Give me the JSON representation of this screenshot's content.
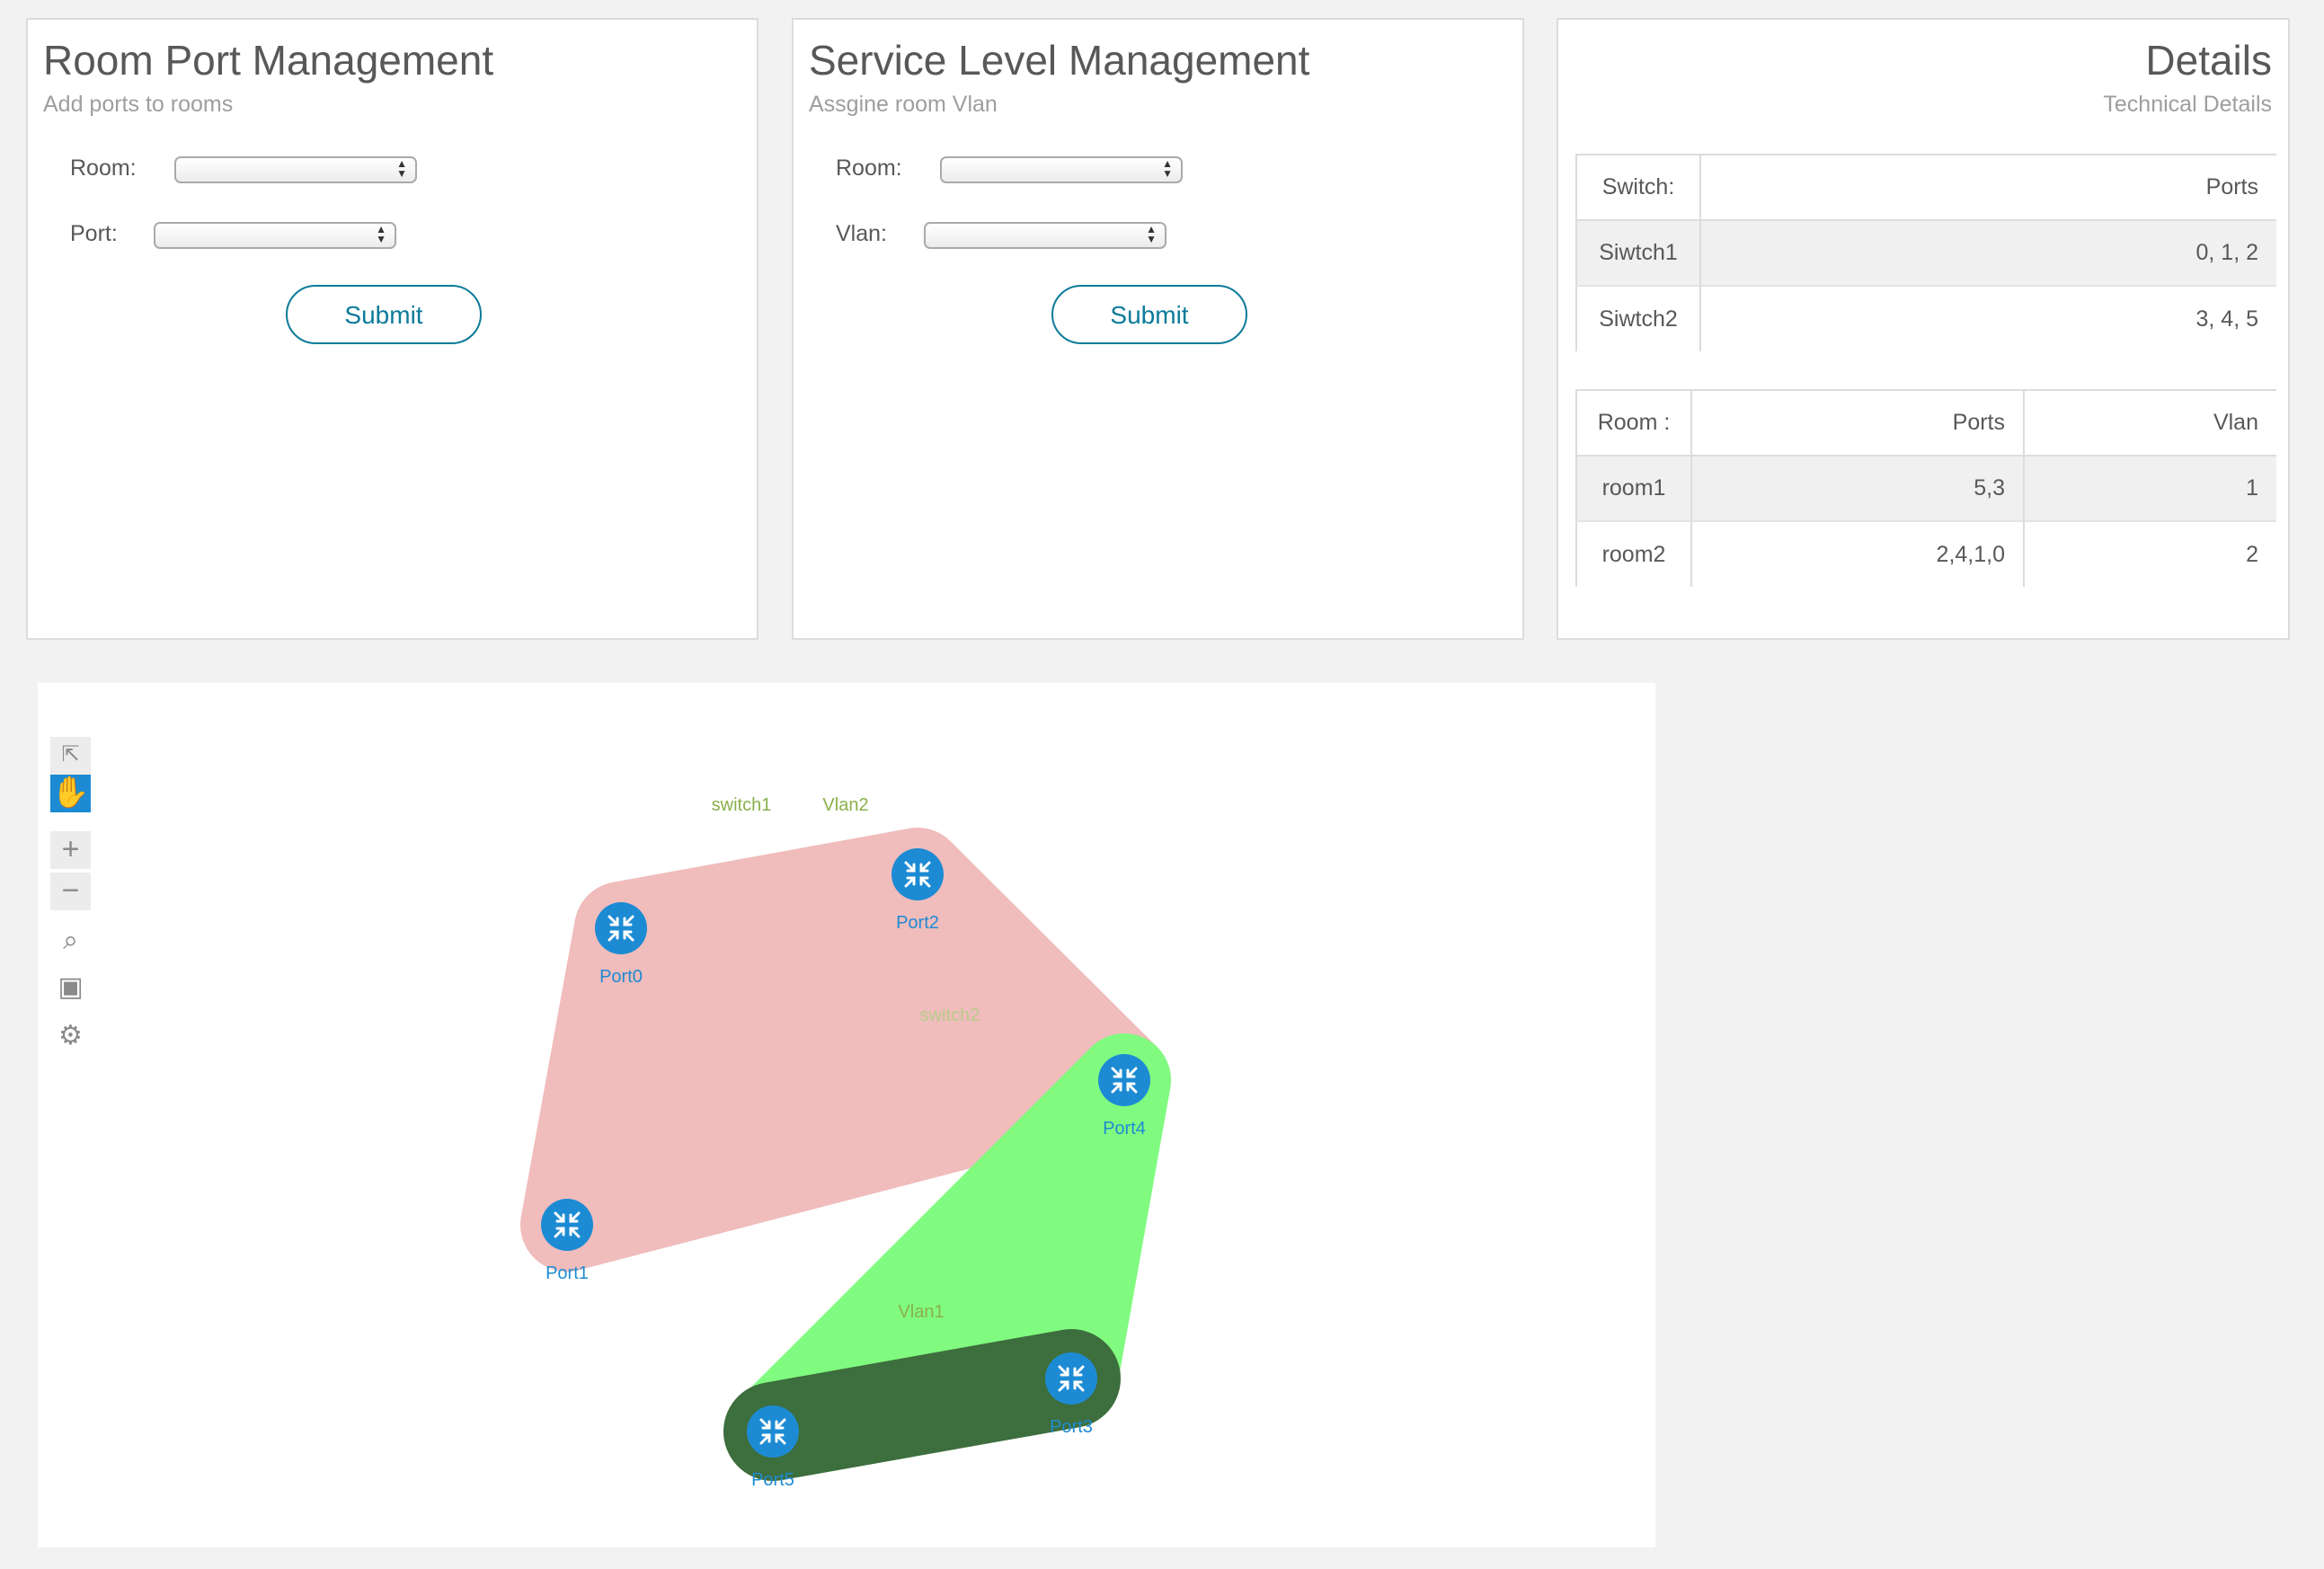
{
  "room_port": {
    "title": "Room Port Management",
    "subtitle": "Add ports to rooms",
    "room_label": "Room:",
    "port_label": "Port:",
    "room_value": "",
    "port_value": "",
    "submit_label": "Submit"
  },
  "service_level": {
    "title": "Service Level Management",
    "subtitle": "Assgine room Vlan",
    "room_label": "Room:",
    "vlan_label": "Vlan:",
    "room_value": "",
    "vlan_value": "",
    "submit_label": "Submit"
  },
  "details": {
    "title": "Details",
    "subtitle": "Technical Details",
    "switch_table": {
      "headers": [
        "Switch:",
        "Ports"
      ],
      "rows": [
        [
          "Siwtch1",
          "0, 1, 2"
        ],
        [
          "Siwtch2",
          "3, 4, 5"
        ]
      ]
    },
    "room_table": {
      "headers": [
        "Room :",
        "Ports",
        "Vlan"
      ],
      "rows": [
        [
          "room1",
          "5,3",
          "1"
        ],
        [
          "room2",
          "2,4,1,0",
          "2"
        ]
      ]
    }
  },
  "topology": {
    "toolbar": [
      {
        "name": "select-mode-icon",
        "glyph": "↖"
      },
      {
        "name": "pan-mode-icon",
        "glyph": "✋"
      },
      {
        "name": "zoom-in-icon",
        "glyph": "+"
      },
      {
        "name": "zoom-out-icon",
        "glyph": "−"
      },
      {
        "name": "zoom-selection-icon",
        "glyph": "⌕"
      },
      {
        "name": "fit-view-icon",
        "glyph": "▣"
      },
      {
        "name": "settings-gear-icon",
        "glyph": "⚙"
      }
    ],
    "node_icon": "switch-arrows-icon",
    "node_color": "#1d8bd3",
    "nodes": [
      {
        "id": "Port0",
        "label": "Port0"
      },
      {
        "id": "Port1",
        "label": "Port1"
      },
      {
        "id": "Port2",
        "label": "Port2"
      },
      {
        "id": "Port3",
        "label": "Port3"
      },
      {
        "id": "Port4",
        "label": "Port4"
      },
      {
        "id": "Port5",
        "label": "Port5"
      }
    ],
    "groups": [
      {
        "label": "switch1",
        "color": "#f4f4f4",
        "label_color": "#8ab04a",
        "members": [
          "Port0",
          "Port1",
          "Port2"
        ]
      },
      {
        "label": "Vlan2",
        "color": "#f0bcbc",
        "label_color": "#8ab04a",
        "members": [
          "Port0",
          "Port1",
          "Port2",
          "Port4"
        ]
      },
      {
        "label": "switch2",
        "color": "#c8f2c8",
        "label_color": "#b8cc8a",
        "members": [
          "Port3",
          "Port4",
          "Port5"
        ]
      },
      {
        "label": "Vlan1",
        "color": "#80fb80",
        "label_color": "#8ab04a",
        "members": [
          "Port4",
          "Port5",
          "Port3"
        ]
      },
      {
        "label": "",
        "color": "#3d6e3d",
        "label_color": "",
        "members": [
          "Port5",
          "Port3"
        ]
      }
    ]
  }
}
